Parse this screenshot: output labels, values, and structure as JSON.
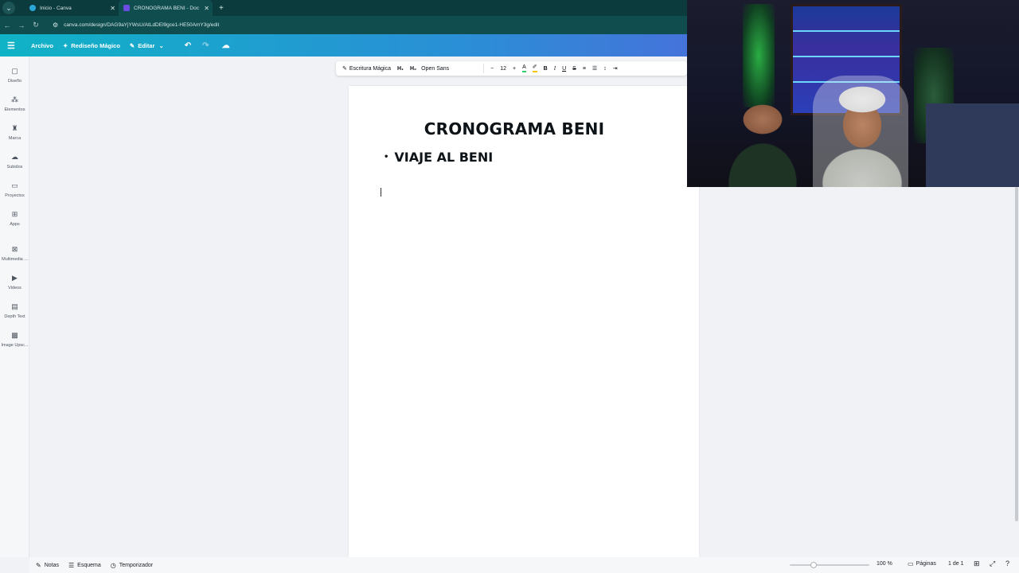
{
  "browser": {
    "tabs": [
      {
        "title": "Inicio - Canva",
        "active": false
      },
      {
        "title": "CRONOGRAMA BENI - Doc",
        "active": true
      }
    ],
    "url": "canva.com/design/DAG9aYjYWsU/AtLdDEl9gce1-HE50AmY3g/edit"
  },
  "header": {
    "archivo": "Archivo",
    "rediseno": "Rediseño Mágico",
    "editar": "Editar"
  },
  "sidebar": {
    "items": [
      {
        "label": "Diseño",
        "icon": "design-icon"
      },
      {
        "label": "Elementos",
        "icon": "elements-icon"
      },
      {
        "label": "Marca",
        "icon": "brand-icon"
      },
      {
        "label": "Subidos",
        "icon": "upload-cloud-icon"
      },
      {
        "label": "Proyectos",
        "icon": "folder-icon"
      },
      {
        "label": "Apps",
        "icon": "apps-icon"
      },
      {
        "label": "Multimedia ...",
        "icon": "multimedia-icon"
      },
      {
        "label": "Videos",
        "icon": "video-icon"
      },
      {
        "label": "Depth Text",
        "icon": "depth-text-icon"
      },
      {
        "label": "Image Upsc...",
        "icon": "image-upscaler-icon"
      }
    ]
  },
  "toolbar": {
    "magic_write": "Escritura Mágica",
    "h1": "H₁",
    "h2": "H₂",
    "font": "Open Sans",
    "font_size": "12",
    "minus": "−",
    "plus": "+",
    "bold": "B",
    "italic": "I",
    "underline": "U",
    "strike": "S"
  },
  "document": {
    "title": "CRONOGRAMA BENI",
    "bullet": "VIAJE AL BENI"
  },
  "statusbar": {
    "notas": "Notas",
    "esquema": "Esquema",
    "temporizador": "Temporizador",
    "zoom": "100 %",
    "zoom_level": 0.3,
    "paginas": "Páginas",
    "page_count": "1 de 1"
  }
}
